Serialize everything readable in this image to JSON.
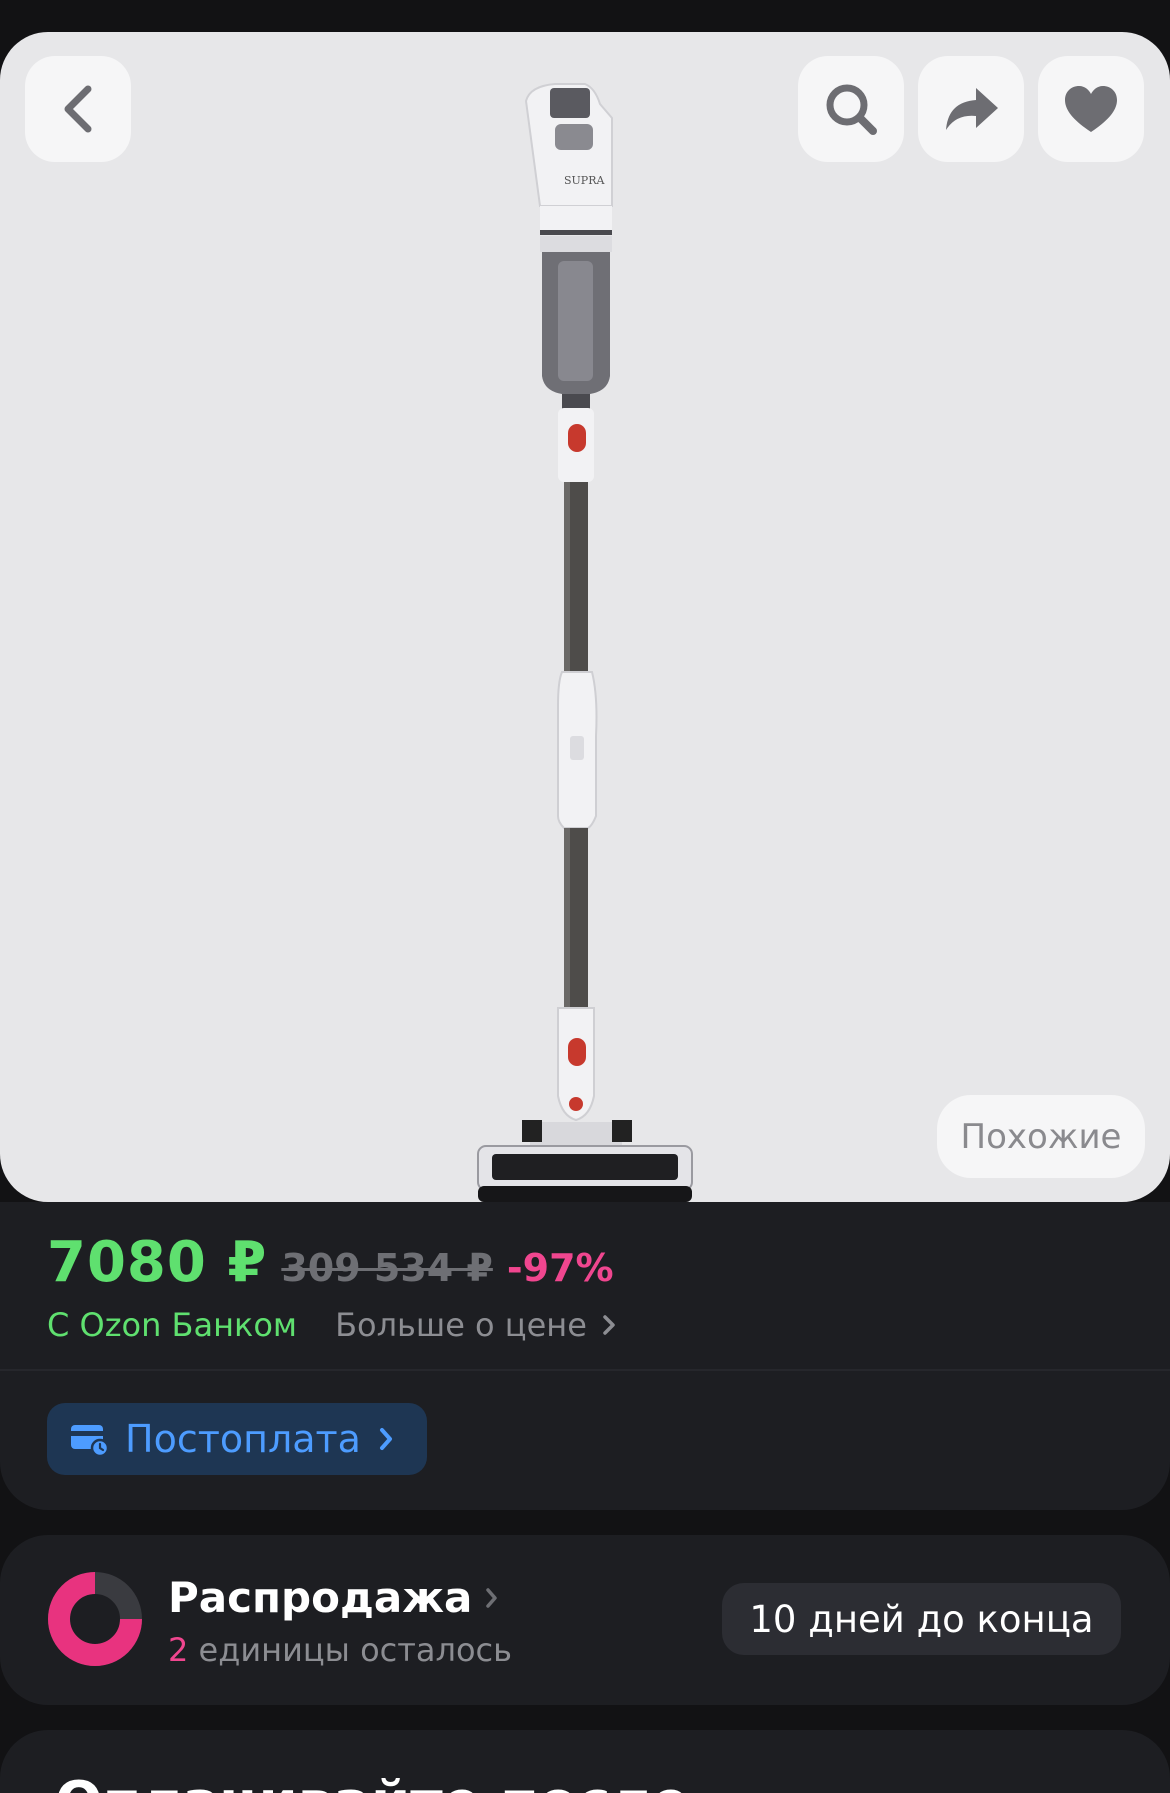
{
  "hero": {
    "back_icon": "chevron-left-icon",
    "search_icon": "search-icon",
    "share_icon": "share-arrow-icon",
    "favorite_icon": "heart-icon",
    "brand_on_product": "SUPRA",
    "similar_label": "Похожие"
  },
  "price": {
    "current": "7080 ₽",
    "old": "309 534 ₽",
    "discount": "-97%",
    "bank_label": "С Ozon Банком",
    "more_label": "Больше о цене"
  },
  "postpay": {
    "label": "Постоплата",
    "icon": "card-clock-icon"
  },
  "sale": {
    "title": "Распродажа",
    "count": "2",
    "units_text": "единицы осталось",
    "days_left": "10 дней до конца"
  },
  "next_section": {
    "title": "Оплачивайте после"
  },
  "colors": {
    "background": "#121214",
    "card": "#1d1e22",
    "price_green": "#5fe06f",
    "discount_pink": "#f0468f",
    "postpay_blue": "#4d9cff"
  }
}
